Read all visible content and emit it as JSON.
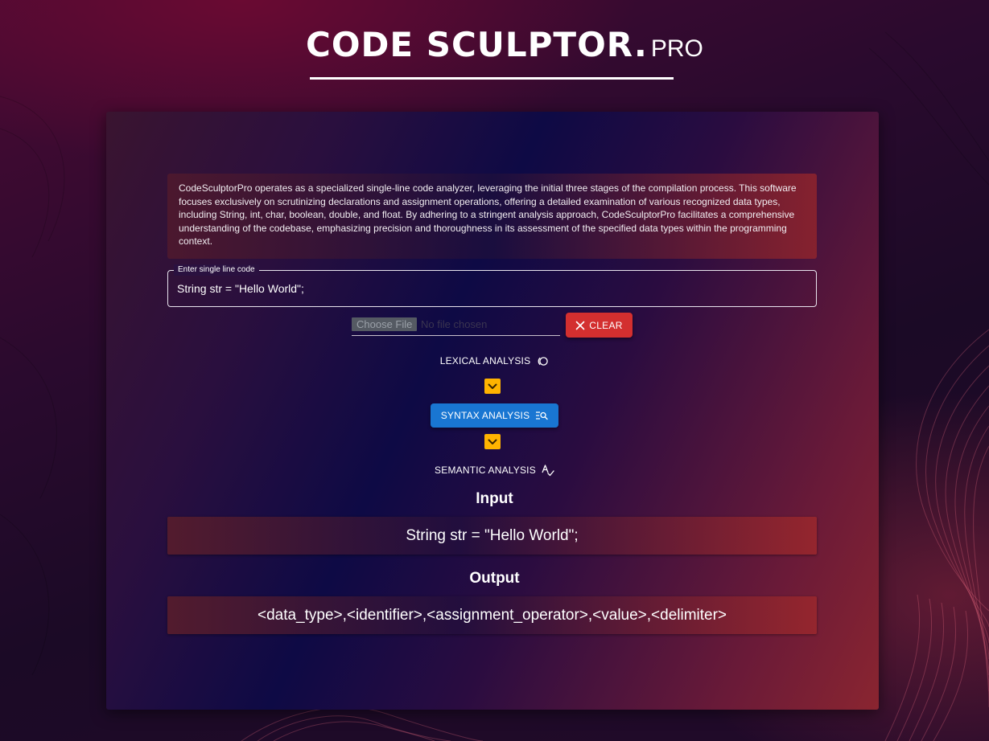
{
  "logo": {
    "main": "CODE SCULPTOR.",
    "suffix": "PRO"
  },
  "description": "CodeSculptorPro operates as a specialized single-line code analyzer, leveraging the initial three stages of the compilation process. This software focuses exclusively on scrutinizing declarations and assignment operations, offering a detailed examination of various recognized data types, including String, int, char, boolean, double, and float. By adhering to a stringent analysis approach, CodeSculptorPro facilitates a comprehensive understanding of the codebase, emphasizing precision and thoroughness in its assessment of the specified data types within the programming context.",
  "code_input": {
    "label": "Enter single line code",
    "value": "String str = \"Hello World\";"
  },
  "file_input": {
    "button_label": "Choose File",
    "status": "No file chosen"
  },
  "clear_button": {
    "label": "CLEAR",
    "icon": "close-icon"
  },
  "steps": [
    {
      "label": "LEXICAL ANALYSIS",
      "icon": "token-icon",
      "active": false
    },
    {
      "label": "SYNTAX ANALYSIS",
      "icon": "manage-search-icon",
      "active": true
    },
    {
      "label": "SEMANTIC ANALYSIS",
      "icon": "spellcheck-icon",
      "active": false
    }
  ],
  "input_section": {
    "title": "Input",
    "value": "String str = \"Hello World\";"
  },
  "output_section": {
    "title": "Output",
    "value": "<data_type>,<identifier>,<assignment_operator>,<value>,<delimiter>"
  },
  "colors": {
    "active_step": "#1976d2",
    "clear_button": "#d32f2f",
    "chevron": "#ffb300"
  }
}
